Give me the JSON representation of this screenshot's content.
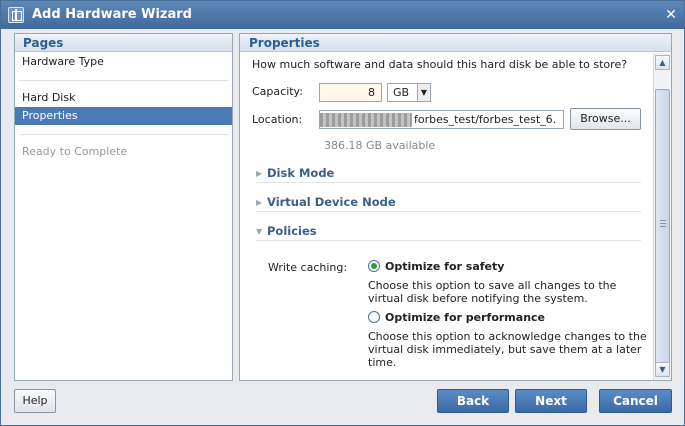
{
  "window": {
    "title": "Add Hardware Wizard",
    "close_glyph": "✕"
  },
  "pages": {
    "header": "Pages",
    "items": [
      {
        "label": "Hardware Type"
      },
      {
        "label": "Hard Disk"
      },
      {
        "label": "Properties"
      },
      {
        "label": "Ready to Complete"
      }
    ]
  },
  "properties": {
    "header": "Properties",
    "question": "How much software and data should this hard disk be able to store?",
    "capacity": {
      "label": "Capacity:",
      "value": "8",
      "unit": "GB"
    },
    "location": {
      "label": "Location:",
      "value": "forbes_test/forbes_test_6.",
      "browse_label": "Browse..."
    },
    "available": "386.18 GB available",
    "sections": [
      {
        "title": "Disk Mode",
        "expanded": false
      },
      {
        "title": "Virtual Device Node",
        "expanded": false
      },
      {
        "title": "Policies",
        "expanded": true
      }
    ],
    "policies": {
      "write_caching_label": "Write caching:",
      "options": [
        {
          "label": "Optimize for safety",
          "checked": true,
          "description": "Choose this option to save all changes to the virtual disk before notifying the system."
        },
        {
          "label": "Optimize for performance",
          "checked": false,
          "description": "Choose this option to acknowledge changes to the virtual disk immediately, but save them at a later time."
        }
      ]
    }
  },
  "buttons": {
    "help": "Help",
    "back": "Back",
    "next": "Next",
    "cancel": "Cancel"
  },
  "colors": {
    "accent": "#4a7ab5",
    "header_text": "#2b5e96",
    "radio_checked": "#2a9d3c"
  },
  "icons": [
    "wizard-icon",
    "close-icon",
    "dropdown-arrow-icon",
    "collapsed-triangle-icon",
    "expanded-triangle-icon",
    "scroll-up-icon",
    "scroll-down-icon"
  ]
}
